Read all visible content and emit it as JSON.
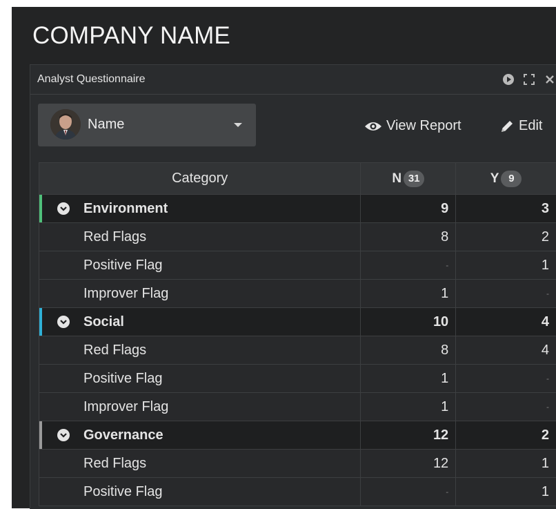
{
  "company_name": "COMPANY NAME",
  "panel": {
    "title": "Analyst Questionnaire",
    "header_icons": [
      "play-circle-icon",
      "expand-icon",
      "close-icon"
    ]
  },
  "selector": {
    "label": "Name",
    "avatar": "user-avatar-photo",
    "caret": "caret-down-icon"
  },
  "actions": {
    "view_report": "View Report",
    "edit": "Edit"
  },
  "table": {
    "columns": {
      "category": "Category",
      "n_label": "N",
      "n_count": "31",
      "y_label": "Y",
      "y_count": "9"
    },
    "groups": [
      {
        "name": "Environment",
        "n": "9",
        "y": "3",
        "accent": "#4fbf7a",
        "rows": [
          {
            "name": "Red Flags",
            "n": "8",
            "y": "2"
          },
          {
            "name": "Positive Flag",
            "n": "-",
            "y": "1"
          },
          {
            "name": "Improver Flag",
            "n": "1",
            "y": "-"
          }
        ]
      },
      {
        "name": "Social",
        "n": "10",
        "y": "4",
        "accent": "#2fb0d6",
        "rows": [
          {
            "name": "Red Flags",
            "n": "8",
            "y": "4"
          },
          {
            "name": "Positive Flag",
            "n": "1",
            "y": "-"
          },
          {
            "name": "Improver Flag",
            "n": "1",
            "y": "-"
          }
        ]
      },
      {
        "name": "Governance",
        "n": "12",
        "y": "2",
        "accent": "#9a9a9a",
        "rows": [
          {
            "name": "Red Flags",
            "n": "12",
            "y": "1"
          },
          {
            "name": "Positive Flag",
            "n": "-",
            "y": "1"
          }
        ]
      }
    ]
  }
}
